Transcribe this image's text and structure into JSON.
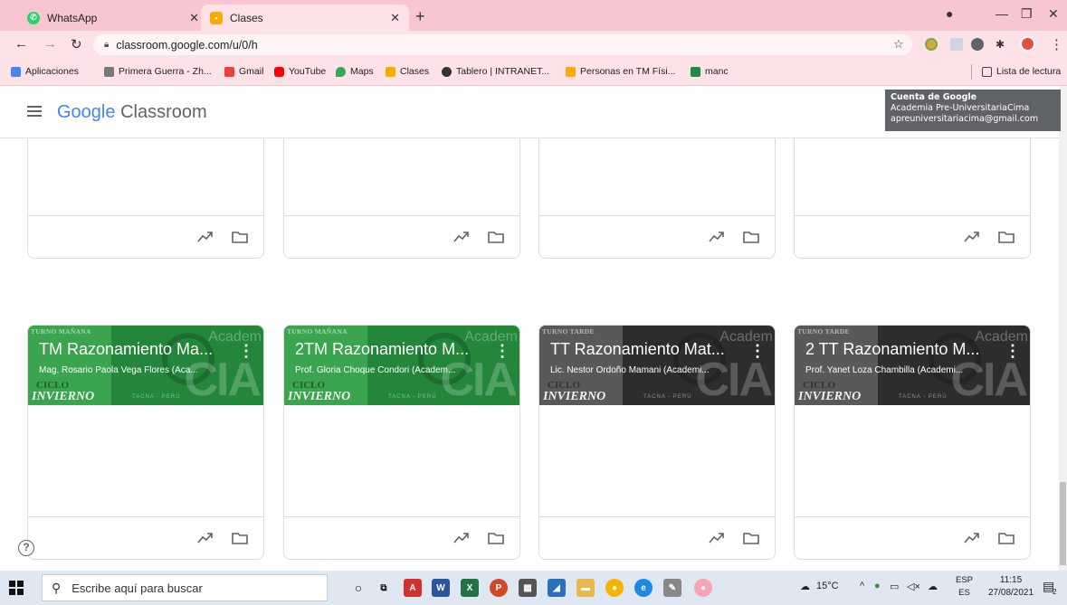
{
  "browser": {
    "tabs": [
      {
        "label": "WhatsApp",
        "color": "#25d366"
      },
      {
        "label": "Clases",
        "color": "#f9ab00"
      }
    ],
    "url": "classroom.google.com/u/0/h",
    "bookmarks": [
      {
        "label": "Aplicaciones",
        "color": "#4285f4"
      },
      {
        "label": "Primera Guerra - Zh...",
        "color": "#777777"
      },
      {
        "label": "Gmail",
        "color": "#ea4335"
      },
      {
        "label": "YouTube",
        "color": "#ff0000"
      },
      {
        "label": "Maps",
        "color": "#34a853"
      },
      {
        "label": "Clases",
        "color": "#f9ab00"
      },
      {
        "label": "Tablero | INTRANET...",
        "color": "#333333"
      },
      {
        "label": "Personas en TM Físi...",
        "color": "#f9ab00"
      },
      {
        "label": "manc",
        "color": "#1e8e3e"
      }
    ],
    "reading_list": "Lista de lectura"
  },
  "app": {
    "brand_google": "Google",
    "brand_product": "Classroom"
  },
  "account_tooltip": {
    "title": "Cuenta de Google",
    "name": "Academia Pre-UniversitariaCima",
    "email": "apreuniversitariacima@gmail.com"
  },
  "banner_text": {
    "turno_manana": "TURNO MAÑANA",
    "turno_tarde": "TURNO TARDE",
    "ciclo": "CICLO",
    "invierno": "INVIERNO",
    "tacna": "TACNA - PERÚ",
    "cia": "CIA",
    "academ": "Academ"
  },
  "top_cards": [
    {
      "theme": "green"
    },
    {
      "theme": "green"
    },
    {
      "theme": "dark"
    },
    {
      "theme": "dark"
    }
  ],
  "classes": [
    {
      "title": "TM Razonamiento Ma...",
      "teacher": "Mag. Rosario Paola Vega Flores (Aca...",
      "theme": "green",
      "turno": "TURNO MAÑANA"
    },
    {
      "title": "2TM Razonamiento M...",
      "teacher": "Prof. Gloria Choque Condori (Academ...",
      "theme": "green",
      "turno": "TURNO MAÑANA"
    },
    {
      "title": "TT Razonamiento Mat...",
      "teacher": "Lic. Nestor Ordoño Mamani (Academi...",
      "theme": "dark",
      "turno": "TURNO TARDE"
    },
    {
      "title": "2 TT Razonamiento M...",
      "teacher": "Prof. Yanet Loza Chambilla (Academi...",
      "theme": "dark",
      "turno": "TURNO TARDE"
    }
  ],
  "help_label": "?",
  "taskbar": {
    "search_placeholder": "Escribe aquí para buscar",
    "weather": "15°C",
    "lang_top": "ESP",
    "lang_bottom": "ES",
    "time": "11:15",
    "date": "27/08/2021",
    "notifications": "2"
  }
}
